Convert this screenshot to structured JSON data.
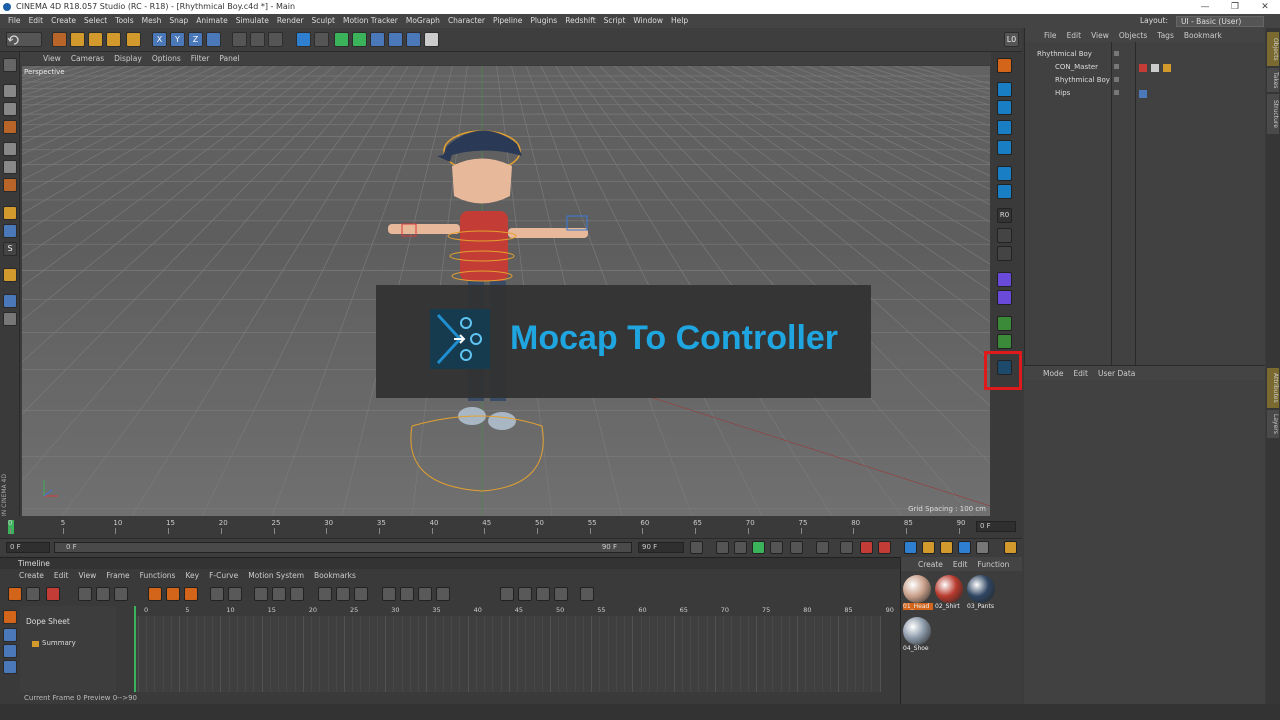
{
  "window": {
    "title": "CINEMA 4D R18.057 Studio (RC - R18) - [Rhythmical Boy.c4d *] - Main",
    "minimize": "—",
    "restore": "❐",
    "close": "✕"
  },
  "menubar": {
    "items": [
      "File",
      "Edit",
      "Create",
      "Select",
      "Tools",
      "Mesh",
      "Snap",
      "Animate",
      "Simulate",
      "Render",
      "Sculpt",
      "Motion Tracker",
      "MoGraph",
      "Character",
      "Pipeline",
      "Plugins",
      "Redshift",
      "Script",
      "Window",
      "Help"
    ],
    "layout_label": "Layout:",
    "layout_value": "UI - Basic (User)"
  },
  "viewport": {
    "menu": [
      "View",
      "Cameras",
      "Display",
      "Options",
      "Filter",
      "Panel"
    ],
    "camera": "Perspective",
    "grid_spacing": "Grid Spacing : 100 cm",
    "overlay_title": "Mocap To Controller"
  },
  "objects": {
    "menu": [
      "File",
      "Edit",
      "View",
      "Objects",
      "Tags",
      "Bookmark"
    ],
    "rows": [
      {
        "name": "Rhythmical Boy"
      },
      {
        "name": "CON_Master"
      },
      {
        "name": "Rhythmical Boy"
      },
      {
        "name": "Hips"
      }
    ]
  },
  "attributes": {
    "menu": [
      "Mode",
      "Edit",
      "User Data"
    ]
  },
  "side_tabs": [
    "Objects",
    "Takes",
    "Structure",
    "Attributes",
    "Layers"
  ],
  "time_ruler": {
    "labels": [
      "0",
      "5",
      "10",
      "15",
      "20",
      "25",
      "30",
      "35",
      "40",
      "45",
      "50",
      "55",
      "60",
      "65",
      "70",
      "75",
      "80",
      "85",
      "90"
    ],
    "end_field": "0 F"
  },
  "playbar": {
    "current": "0 F",
    "start": "0 F",
    "range_end": "90 F",
    "end": "90 F"
  },
  "timeline": {
    "title": "Timeline",
    "menu": [
      "Create",
      "Edit",
      "View",
      "Frame",
      "Functions",
      "Key",
      "F-Curve",
      "Motion System",
      "Bookmarks"
    ],
    "dope_sheet": "Dope Sheet",
    "summary": "Summary",
    "frames": [
      "0",
      "5",
      "10",
      "15",
      "20",
      "25",
      "30",
      "35",
      "40",
      "45",
      "50",
      "55",
      "60",
      "65",
      "70",
      "75",
      "80",
      "85",
      "90"
    ],
    "status": "Current Frame  0  Preview  0-->90"
  },
  "materials": {
    "menu": [
      "Create",
      "Edit",
      "Function"
    ],
    "items": [
      {
        "label": "01_Head",
        "color": "#c9a08a"
      },
      {
        "label": "02_Shirt",
        "color": "#b83a2e"
      },
      {
        "label": "03_Pants",
        "color": "#2f4663"
      },
      {
        "label": "04_Shoe",
        "color": "#8a98a8"
      }
    ]
  },
  "colors": {
    "accent_blue": "#1fa6e0",
    "highlight_red": "#e01a1a",
    "ui_bg": "#3b3b3b"
  }
}
